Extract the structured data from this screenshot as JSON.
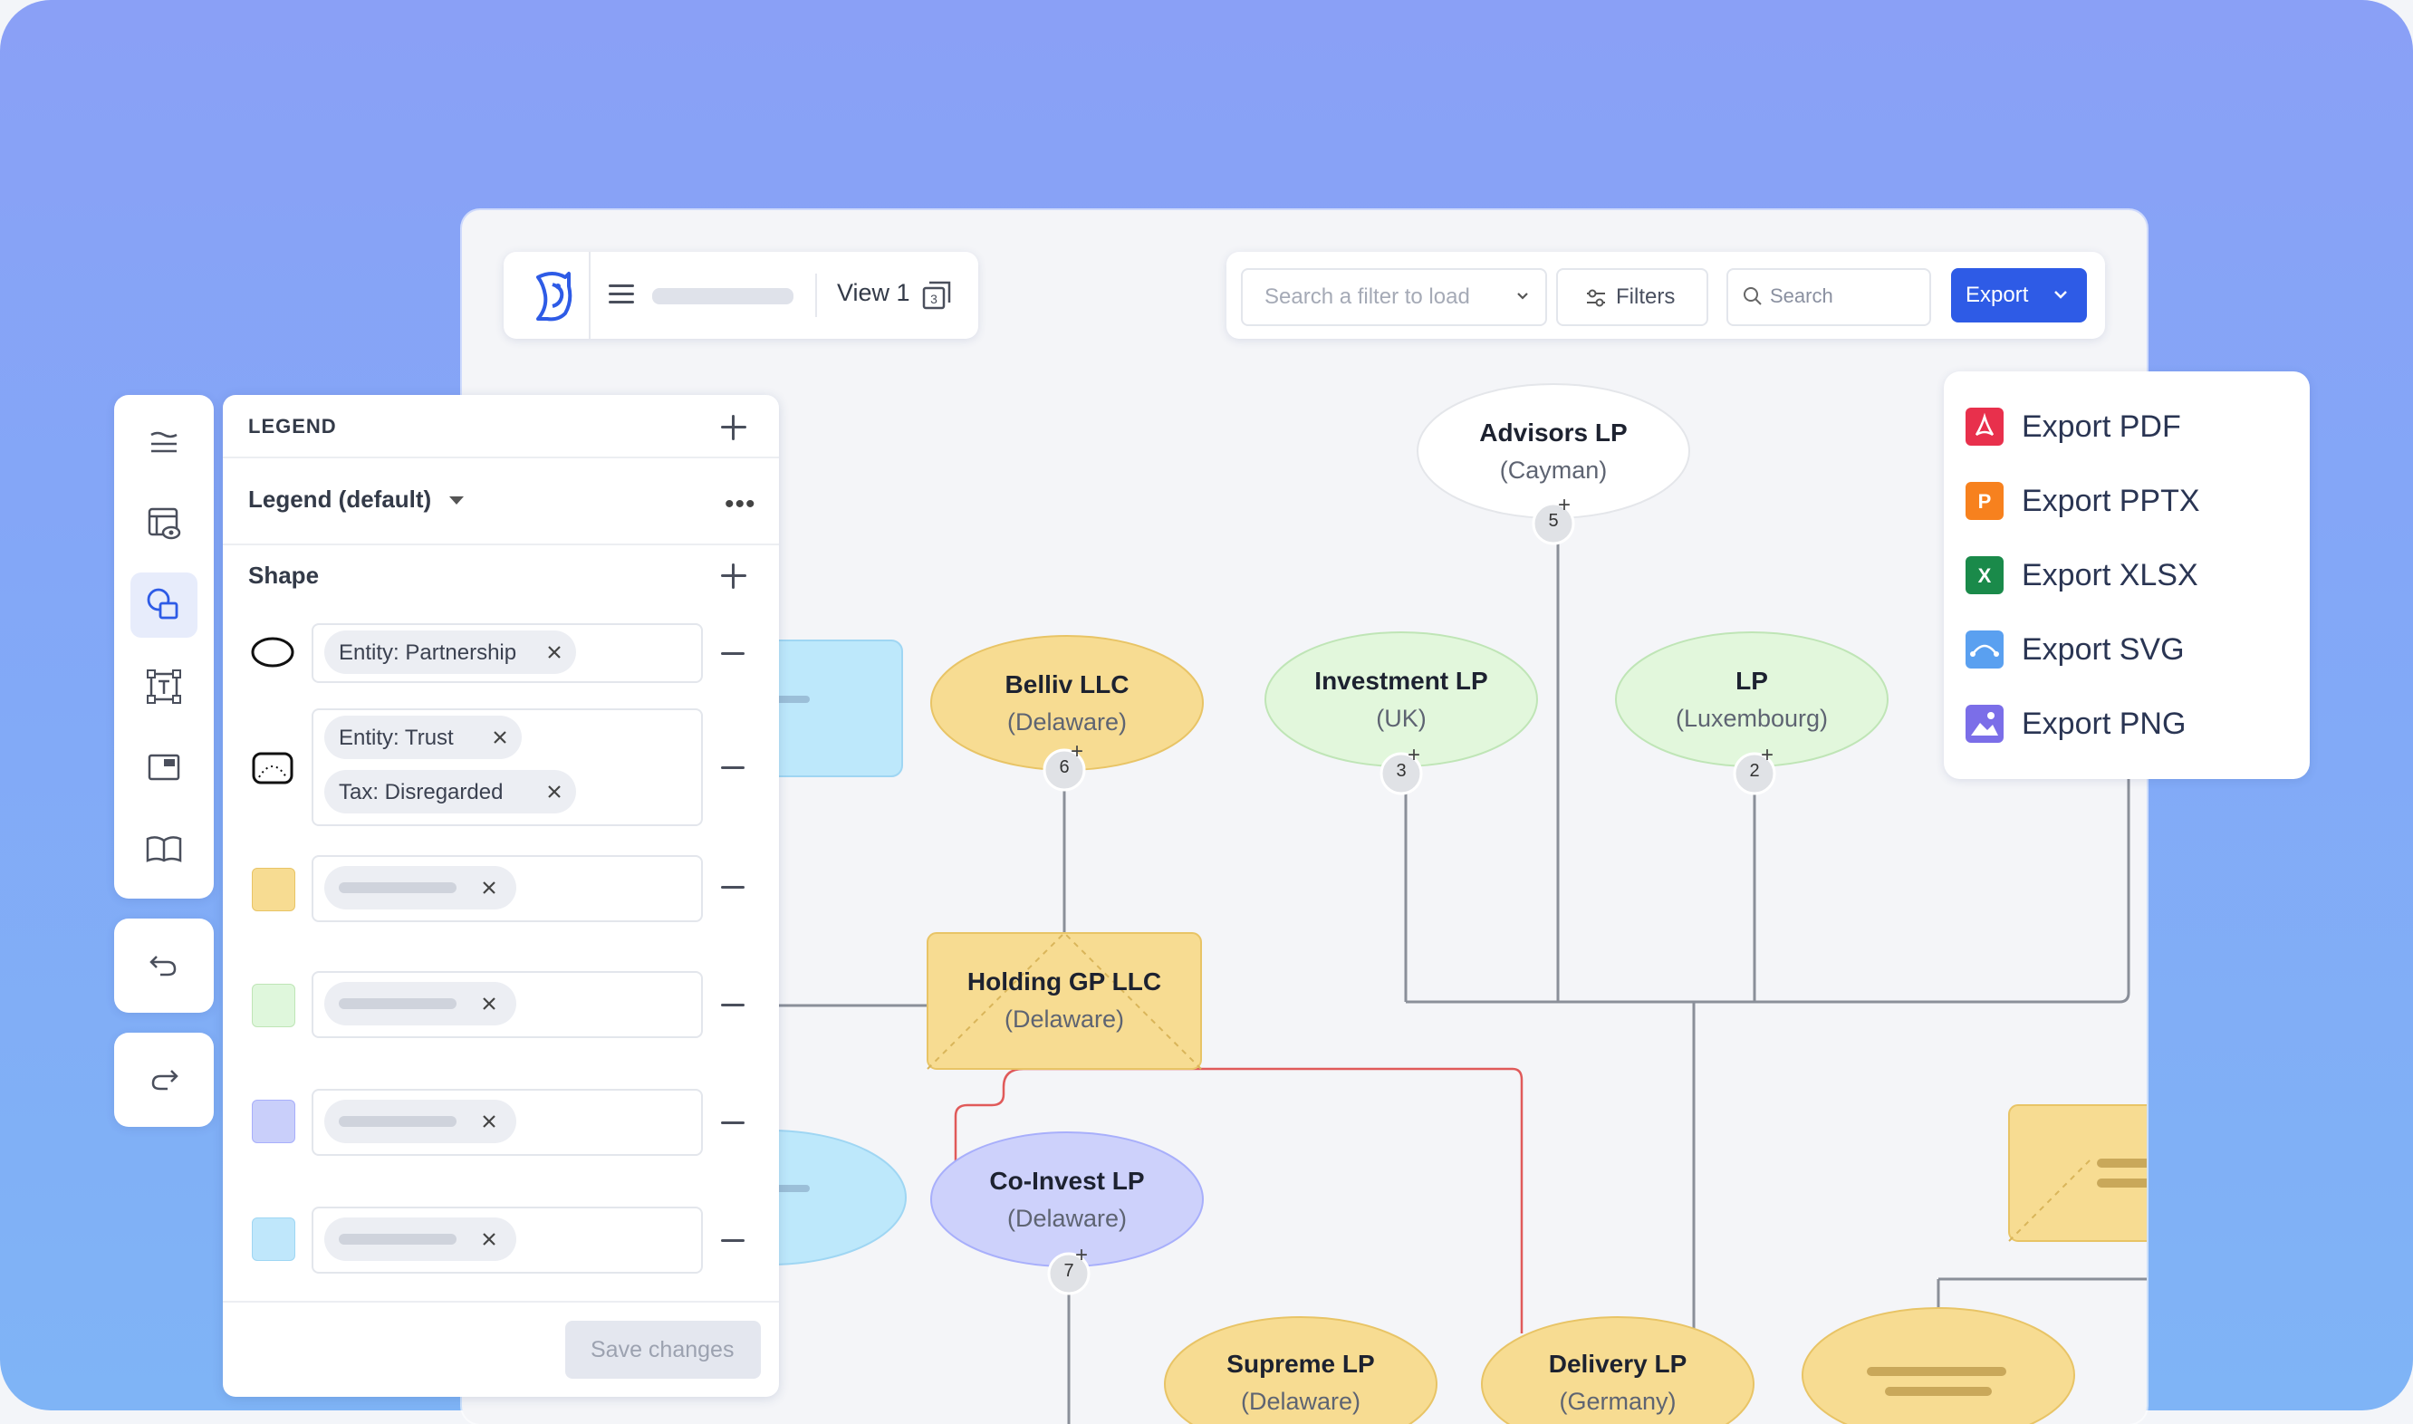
{
  "toolbar": {
    "view_label": "View 1",
    "filter_placeholder": "Search a filter to load",
    "filters_label": "Filters",
    "search_placeholder": "Search",
    "export_label": "Export"
  },
  "export_menu": {
    "items": [
      {
        "label": "Export PDF",
        "icon": "pdf-icon",
        "color": "#e8304c"
      },
      {
        "label": "Export PPTX",
        "icon": "pptx-icon",
        "color": "#f7811e"
      },
      {
        "label": "Export XLSX",
        "icon": "xlsx-icon",
        "color": "#1a8a4a"
      },
      {
        "label": "Export SVG",
        "icon": "svg-icon",
        "color": "#5aa0f0"
      },
      {
        "label": "Export PNG",
        "icon": "png-icon",
        "color": "#7b6ee8"
      }
    ]
  },
  "rail": {
    "icons": [
      "layers-icon",
      "table-view-icon",
      "shapes-icon",
      "text-frame-icon",
      "window-icon",
      "book-icon"
    ],
    "undo": "undo-icon",
    "redo": "redo-icon"
  },
  "legend": {
    "header": "LEGEND",
    "name": "Legend (default)",
    "shape_header": "Shape",
    "rows": [
      {
        "chips": [
          "Entity: Partnership"
        ],
        "symbol": "ellipse"
      },
      {
        "chips": [
          "Entity: Trust",
          "Tax: Disregarded"
        ],
        "symbol": "trust"
      },
      {
        "swatch": "#f7dc92"
      },
      {
        "swatch": "#dff7dc"
      },
      {
        "swatch": "#c9cffa"
      },
      {
        "swatch": "#bfe7fb"
      }
    ],
    "save_label": "Save changes"
  },
  "nodes": [
    {
      "name": "Advisors LP",
      "sub": "(Cayman)",
      "badge": "5"
    },
    {
      "name": "Belliv LLC",
      "sub": "(Delaware)",
      "badge": "6"
    },
    {
      "name": "Investment LP",
      "sub": "(UK)",
      "badge": "3"
    },
    {
      "name": "LP",
      "sub": "(Luxembourg)",
      "badge": "2"
    },
    {
      "name": "Holding GP LLC",
      "sub": "(Delaware)"
    },
    {
      "name": "Co-Invest LP",
      "sub": "(Delaware)",
      "badge": "7"
    },
    {
      "name": "Supreme LP",
      "sub": "(Delaware)"
    },
    {
      "name": "Delivery LP",
      "sub": "(Germany)"
    }
  ],
  "colors": {
    "accent": "#2e5be6",
    "yellow": "#f7dc92",
    "green": "#e2f7dc",
    "purple": "#cdd1fb",
    "blue": "#bde8fb",
    "red_line": "#e05a5a"
  }
}
